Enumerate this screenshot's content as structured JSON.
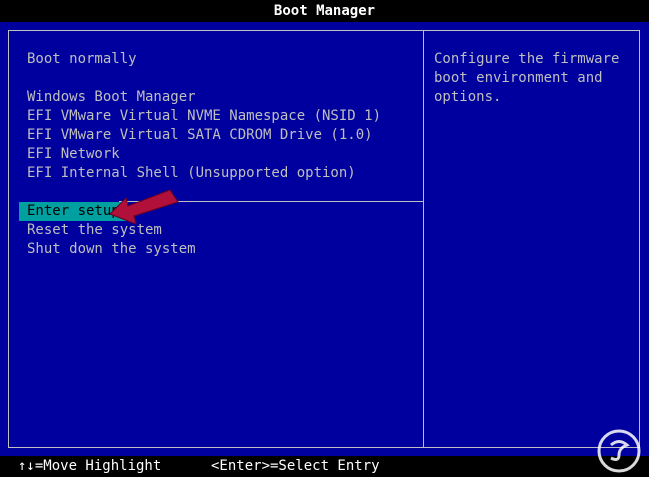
{
  "window": {
    "title": "Boot Manager"
  },
  "menu": {
    "items": [
      {
        "label": "Boot normally"
      },
      {
        "label": "Windows Boot Manager"
      },
      {
        "label": "EFI VMware Virtual NVME Namespace (NSID 1)"
      },
      {
        "label": "EFI VMware Virtual SATA CDROM Drive (1.0)"
      },
      {
        "label": "EFI Network"
      },
      {
        "label": "EFI Internal Shell (Unsupported option)"
      },
      {
        "label": "Enter setup",
        "selected": true
      },
      {
        "label": "Reset the system"
      },
      {
        "label": "Shut down the system"
      }
    ]
  },
  "help": {
    "text": "Configure the firmware\nboot environment and\noptions."
  },
  "status": {
    "move_hint": "↑↓=Move Highlight",
    "select_hint": "<Enter>=Select Entry"
  },
  "colors": {
    "background": "#00009f",
    "text": "#bfbfbf",
    "highlight": "#00a0a0",
    "arrow": "#b0103a"
  },
  "icons": {
    "pointer": "red-arrow-icon",
    "watermark": "solvetic-logo-icon"
  }
}
